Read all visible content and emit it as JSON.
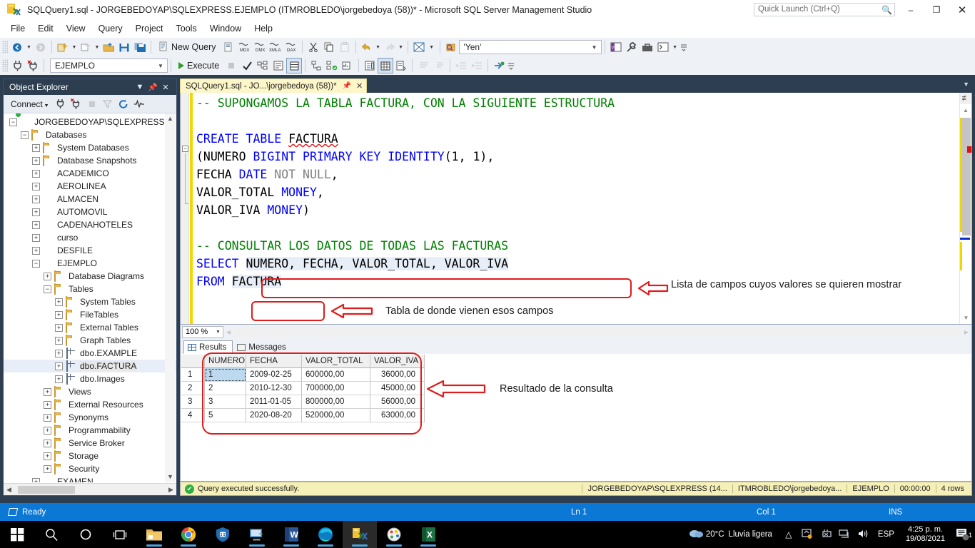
{
  "window": {
    "title": "SQLQuery1.sql - JORGEBEDOYAP\\SQLEXPRESS.EJEMPLO (ITMROBLEDO\\jorgebedoya (58))* - Microsoft SQL Server Management Studio",
    "quick_launch_placeholder": "Quick Launch (Ctrl+Q)",
    "minimize": "–",
    "maximize": "❐",
    "close": "✕"
  },
  "menu": {
    "items": [
      "File",
      "Edit",
      "View",
      "Query",
      "Project",
      "Tools",
      "Window",
      "Help"
    ]
  },
  "toolbar": {
    "new_query_label": "New Query",
    "execute_label": "Execute",
    "find_value": "'Yen'",
    "database_value": "EJEMPLO"
  },
  "object_explorer": {
    "title": "Object Explorer",
    "connect_label": "Connect",
    "nodes": [
      {
        "label": "JORGEBEDOYAP\\SQLEXPRESS (S...",
        "indent": 0,
        "expander": "-",
        "icon": "server-icon"
      },
      {
        "label": "Databases",
        "indent": 1,
        "expander": "-",
        "icon": "folder-icon"
      },
      {
        "label": "System Databases",
        "indent": 2,
        "expander": "+",
        "icon": "folder-icon"
      },
      {
        "label": "Database Snapshots",
        "indent": 2,
        "expander": "+",
        "icon": "folder-icon"
      },
      {
        "label": "ACADEMICO",
        "indent": 2,
        "expander": "+",
        "icon": "database-icon"
      },
      {
        "label": "AEROLINEA",
        "indent": 2,
        "expander": "+",
        "icon": "database-icon"
      },
      {
        "label": "ALMACEN",
        "indent": 2,
        "expander": "+",
        "icon": "database-icon"
      },
      {
        "label": "AUTOMOVIL",
        "indent": 2,
        "expander": "+",
        "icon": "database-icon"
      },
      {
        "label": "CADENAHOTELES",
        "indent": 2,
        "expander": "+",
        "icon": "database-icon"
      },
      {
        "label": "curso",
        "indent": 2,
        "expander": "+",
        "icon": "database-icon"
      },
      {
        "label": "DESFILE",
        "indent": 2,
        "expander": "+",
        "icon": "database-icon"
      },
      {
        "label": "EJEMPLO",
        "indent": 2,
        "expander": "-",
        "icon": "database-icon"
      },
      {
        "label": "Database Diagrams",
        "indent": 3,
        "expander": "+",
        "icon": "folder-icon"
      },
      {
        "label": "Tables",
        "indent": 3,
        "expander": "-",
        "icon": "folder-icon"
      },
      {
        "label": "System Tables",
        "indent": 4,
        "expander": "+",
        "icon": "folder-icon"
      },
      {
        "label": "FileTables",
        "indent": 4,
        "expander": "+",
        "icon": "folder-icon"
      },
      {
        "label": "External Tables",
        "indent": 4,
        "expander": "+",
        "icon": "folder-icon"
      },
      {
        "label": "Graph Tables",
        "indent": 4,
        "expander": "+",
        "icon": "folder-icon"
      },
      {
        "label": "dbo.EXAMPLE",
        "indent": 4,
        "expander": "+",
        "icon": "table-icon"
      },
      {
        "label": "dbo.FACTURA",
        "indent": 4,
        "expander": "+",
        "icon": "table-icon",
        "selected": true
      },
      {
        "label": "dbo.Images",
        "indent": 4,
        "expander": "+",
        "icon": "table-icon"
      },
      {
        "label": "Views",
        "indent": 3,
        "expander": "+",
        "icon": "folder-icon"
      },
      {
        "label": "External Resources",
        "indent": 3,
        "expander": "+",
        "icon": "folder-icon"
      },
      {
        "label": "Synonyms",
        "indent": 3,
        "expander": "+",
        "icon": "folder-icon"
      },
      {
        "label": "Programmability",
        "indent": 3,
        "expander": "+",
        "icon": "folder-icon"
      },
      {
        "label": "Service Broker",
        "indent": 3,
        "expander": "+",
        "icon": "folder-icon"
      },
      {
        "label": "Storage",
        "indent": 3,
        "expander": "+",
        "icon": "folder-icon"
      },
      {
        "label": "Security",
        "indent": 3,
        "expander": "+",
        "icon": "folder-icon"
      },
      {
        "label": "EXAMEN",
        "indent": 2,
        "expander": "+",
        "icon": "database-icon"
      }
    ]
  },
  "editor": {
    "tab_label": "SQLQuery1.sql - JO...\\jorgebedoya (58))*",
    "zoom_value": "100 %",
    "lines": [
      "-- SUPONGAMOS LA TABLA FACTURA, CON LA SIGUIENTE ESTRUCTURA",
      "",
      "CREATE TABLE FACTURA",
      "(NUMERO BIGINT PRIMARY KEY IDENTITY(1, 1),",
      "FECHA DATE NOT NULL,",
      "VALOR_TOTAL MONEY,",
      "VALOR_IVA MONEY)",
      "",
      "-- CONSULTAR LOS DATOS DE TODAS LAS FACTURAS",
      "SELECT NUMERO, FECHA, VALOR_TOTAL, VALOR_IVA",
      "FROM FACTURA"
    ]
  },
  "results": {
    "tabs": [
      {
        "label": "Results",
        "icon": "grid-icon",
        "active": true
      },
      {
        "label": "Messages",
        "icon": "messages-icon",
        "active": false
      }
    ],
    "columns": [
      "NUMERO",
      "FECHA",
      "VALOR_TOTAL",
      "VALOR_IVA"
    ],
    "rows": [
      {
        "n": "1",
        "cells": [
          "1",
          "2009-02-25",
          "600000,00",
          "36000,00"
        ]
      },
      {
        "n": "2",
        "cells": [
          "2",
          "2010-12-30",
          "700000,00",
          "45000,00"
        ]
      },
      {
        "n": "3",
        "cells": [
          "3",
          "2011-01-05",
          "800000,00",
          "56000,00"
        ]
      },
      {
        "n": "4",
        "cells": [
          "5",
          "2020-08-20",
          "520000,00",
          "63000,00"
        ]
      }
    ]
  },
  "query_status": {
    "message": "Query executed successfully.",
    "server": "JORGEBEDOYAP\\SQLEXPRESS (14...",
    "user": "ITMROBLEDO\\jorgebedoya...",
    "database": "EJEMPLO",
    "elapsed": "00:00:00",
    "rowcount": "4 rows"
  },
  "ide_status": {
    "state": "Ready",
    "line": "Ln 1",
    "column": "Col 1",
    "insert_mode": "INS"
  },
  "annotations": [
    {
      "id": "fields-note",
      "text": "Lista de campos cuyos valores se quieren mostrar"
    },
    {
      "id": "table-note",
      "text": "Tabla de donde vienen esos campos"
    },
    {
      "id": "result-note",
      "text": "Resultado de la consulta"
    }
  ],
  "taskbar": {
    "icons": [
      "start-icon",
      "search-icon",
      "cortana-icon",
      "task-view-icon",
      "file-explorer-icon",
      "chrome-icon",
      "security-icon",
      "remote-desktop-icon",
      "word-icon",
      "edge-icon",
      "ssms-icon",
      "paint-icon",
      "excel-icon"
    ],
    "weather_temp": "20°C",
    "weather_desc": "Lluvia ligera",
    "language": "ESP",
    "time": "4:25 p. m.",
    "date": "19/08/2021",
    "notification_count": "1"
  },
  "colors": {
    "accent": "#2d3e50",
    "annotation_red": "#e01b1b",
    "keyword_blue": "#0000ff",
    "comment_green": "#008000",
    "status_blue": "#0a78d4",
    "query_status_bg": "#f5f0b8"
  }
}
